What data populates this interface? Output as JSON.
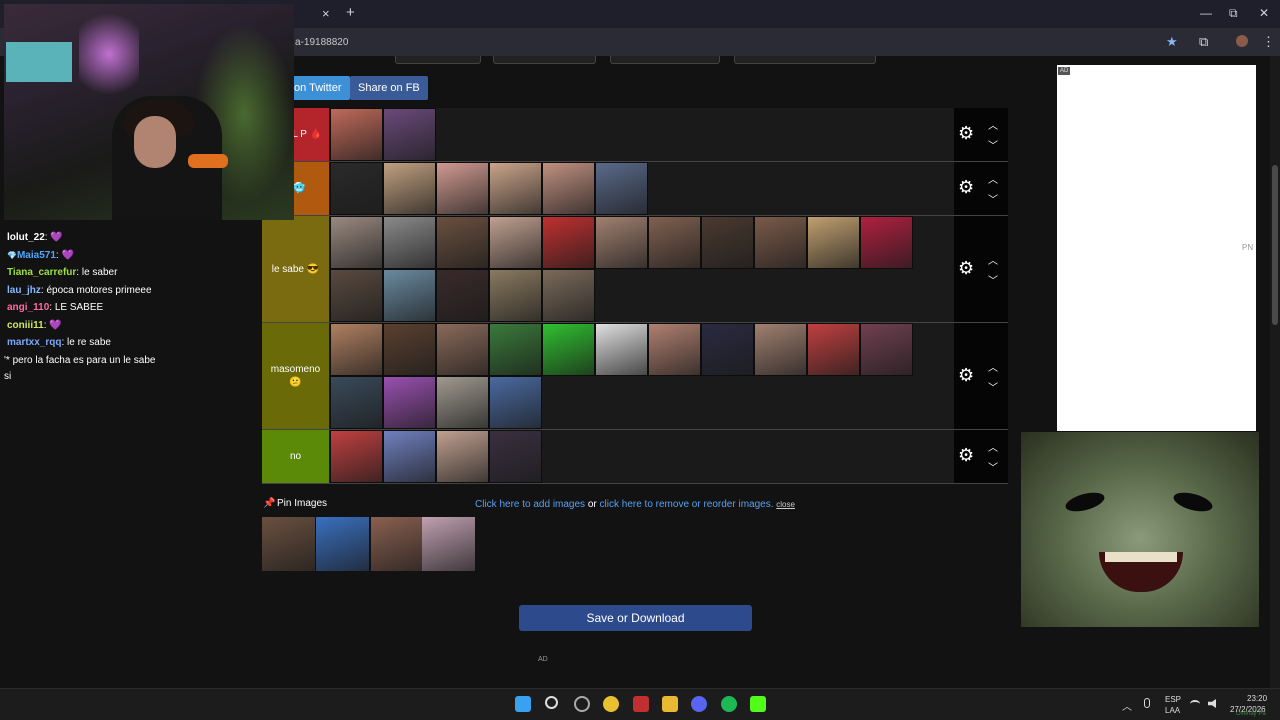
{
  "browser": {
    "url_partial": "a-19188820",
    "tab_close": "×",
    "new_tab": "+",
    "min": "—",
    "restore": "⧉",
    "close": "✕",
    "star": "★",
    "ext": "⧉",
    "menu": "⋮"
  },
  "share": {
    "twitter": "on Twitter",
    "facebook": "Share on FB"
  },
  "tiers": [
    {
      "label": "S DEL P 🩸",
      "color": "#b3252a",
      "rows": 1,
      "images": [
        "#c06a5a",
        "#6a4a7a"
      ]
    },
    {
      "label": "g 🥶",
      "color": "#b05a10",
      "rows": 1,
      "images": [
        "#2a2a2a",
        "#c0a080",
        "#d09a90",
        "#caa48a",
        "#c09080",
        "#5a6a8a"
      ]
    },
    {
      "label": "le sabe 😎",
      "color": "#7a6a10",
      "rows": 2,
      "images": [
        "#9a8a80",
        "#8a8a8a",
        "#6a5040",
        "#c0a090",
        "#c03030",
        "#a08070",
        "#806050",
        "#4a3a30",
        "#7a5a4a",
        "#c0a070",
        "#b02040",
        "#5a4a40",
        "#6a8aa0",
        "#3a2a2a",
        "#8a7a60",
        "#7a6a5a"
      ]
    },
    {
      "label": "masomeno 😕",
      "color": "#6a6a08",
      "rows": 2,
      "images": [
        "#b08060",
        "#5a4030",
        "#8a6a5a",
        "#3a7a3a",
        "#30c030",
        "#e0e0e0",
        "#b08070",
        "#2a2a40",
        "#a08070",
        "#c04040",
        "#704050",
        "#3a4a5a",
        "#9a50b0",
        "#a09a90",
        "#4a6aa0"
      ]
    },
    {
      "label": "no",
      "color": "#5a8a08",
      "rows": 1,
      "images": [
        "#c04040",
        "#7080c0",
        "#c0a090",
        "#3a3040"
      ]
    }
  ],
  "tier_controls": {
    "gear": "⚙",
    "up": "︿",
    "down": "﹀"
  },
  "pin": {
    "icon": "📌",
    "title": "Pin Images",
    "images": [
      "#6a5040",
      "#3a70c0",
      "#8a6050",
      "#c0a0b0"
    ]
  },
  "links": {
    "add": "Click here to add images",
    "or": "or",
    "remove": "click here to remove or reorder images.",
    "close": "close"
  },
  "save_button": "Save or Download",
  "ad_label": "AD",
  "ad_side_text": "PN",
  "chat": [
    {
      "user": "lolut_22",
      "color": "#ffffff",
      "msg": " 💜"
    },
    {
      "user": "Maia571",
      "color": "#4aa8ff",
      "badge": "💎",
      "msg": " 💜"
    },
    {
      "user": "Tiana_carrefur",
      "color": "#9fdf40",
      "msg": " le saber"
    },
    {
      "user": "lau_jhz",
      "color": "#8ab8ff",
      "msg": " época motores primeee"
    },
    {
      "user": "angi_110",
      "color": "#ff6aa0",
      "msg": " LE SABEE"
    },
    {
      "user": "coniii11",
      "color": "#cfe860",
      "msg": " 💜"
    },
    {
      "user": "martxx_rqq",
      "color": "#7aa8ff",
      "msg": " le re sabe"
    }
  ],
  "chat_extra": [
    "'* pero la facha es para un le sabe",
    "si"
  ],
  "taskbar": {
    "lang1": "ESP",
    "lang2": "LAA",
    "time": "23:20",
    "date": "27/2/2026",
    "chevron": "︿"
  },
  "watermark": "Overlay Pa"
}
